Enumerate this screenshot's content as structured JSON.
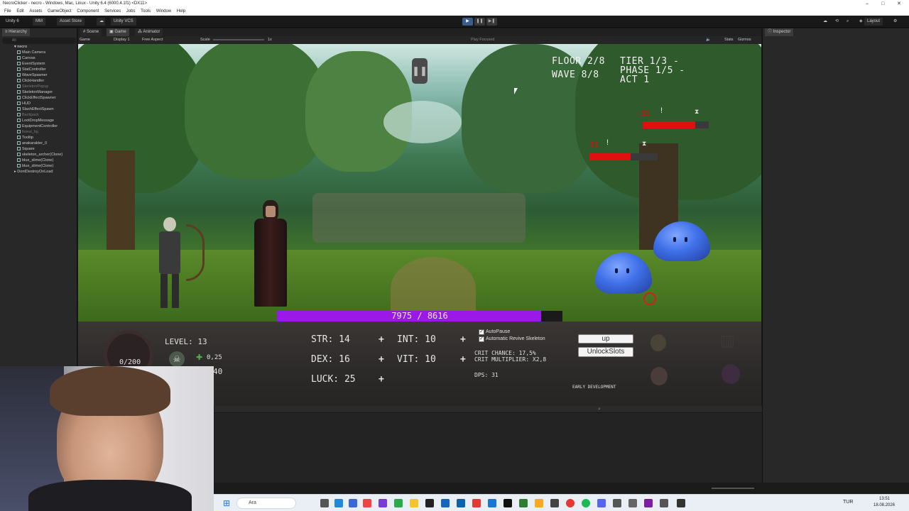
{
  "window": {
    "title": "NecroClicker - necro - Windows, Mac, Linux - Unity 6.4 (6000.4.1f1) <DX11>"
  },
  "menu": [
    "File",
    "Edit",
    "Assets",
    "GameObject",
    "Component",
    "Services",
    "Jobs",
    "Tools",
    "Window",
    "Help"
  ],
  "toolbar": {
    "unity_label": "Unity 6",
    "account": "MM",
    "asset_store": "Asset Store",
    "vcs": "Unity VCS",
    "layout": "Layout"
  },
  "hierarchy": {
    "tab": "Hierarchy",
    "search_placeholder": "All",
    "root": "necro",
    "items": [
      {
        "label": "Main Camera",
        "dim": false
      },
      {
        "label": "Canvas",
        "dim": false
      },
      {
        "label": "EventSystem",
        "dim": false
      },
      {
        "label": "StatController",
        "dim": false
      },
      {
        "label": "WaveSpawner",
        "dim": false
      },
      {
        "label": "ClickHandler",
        "dim": false
      },
      {
        "label": "SkeletonPopup",
        "dim": true
      },
      {
        "label": "SkeletonManager",
        "dim": false
      },
      {
        "label": "ClickEffectSpawner",
        "dim": false
      },
      {
        "label": "HUD",
        "dim": false
      },
      {
        "label": "SlashEffectSpawn",
        "dim": false
      },
      {
        "label": "Backpack",
        "dim": true
      },
      {
        "label": "LootDropMessage",
        "dim": false
      },
      {
        "label": "EquipmentController",
        "dim": false
      },
      {
        "label": "forest_bg",
        "dim": true
      },
      {
        "label": "Tooltip",
        "dim": false
      },
      {
        "label": "anakarakter_0",
        "dim": false
      },
      {
        "label": "Square",
        "dim": false
      },
      {
        "label": "skeleton_archer(Clone)",
        "dim": false
      },
      {
        "label": "blue_slime(Clone)",
        "dim": false
      },
      {
        "label": "blue_slime(Clone)",
        "dim": false
      }
    ],
    "dontdestroy": "DontDestroyOnLoad"
  },
  "view_tabs": {
    "scene": "Scene",
    "game": "Game",
    "animator": "Animator"
  },
  "game_toolbar": {
    "mode": "Game",
    "display": "Display 1",
    "aspect": "Free Aspect",
    "scale_label": "Scale",
    "scale_value": "1x",
    "play_focused": "Play Focused",
    "stats": "Stats",
    "gizmos": "Gizmos"
  },
  "inspector": {
    "tab": "Inspector"
  },
  "game": {
    "floor": "FLOOR 2/8",
    "tier": "TIER 1/3  -",
    "wave": "WAVE 8/8",
    "phase": "PHASE 1/5  -",
    "act": "ACT 1",
    "enemies": [
      {
        "damage": "31",
        "hp_fraction": 0.8
      },
      {
        "damage": "31",
        "hp_fraction": 0.6
      }
    ],
    "player_hp": {
      "current": 7975,
      "max": 8616,
      "label": "7975 / 8616"
    }
  },
  "panel": {
    "xp": "0/200",
    "level": "LEVEL: 13",
    "souls_rate": "0,25",
    "souls_count": "40",
    "stats": {
      "str": "STR: 14",
      "int": "INT: 10",
      "dex": "DEX: 16",
      "vit": "VIT: 10",
      "luck": "LUCK: 25"
    },
    "plus": "+",
    "autopause": "AutoPause",
    "auto_revive": "Automatic Revive Skeleton",
    "crit_chance": "CRIT CHANCE: 17,5%",
    "crit_multiplier": "CRIT MULTIPLIER: X2,8",
    "dps": "DPS: 31",
    "btn_up": "up",
    "btn_unlock": "UnlockSlots",
    "early_dev": "EARLY DEVELOPMENT"
  },
  "taskbar": {
    "search_placeholder": "Ara",
    "lang": "TUR",
    "time": "13:51",
    "date": "18.08.2026"
  }
}
